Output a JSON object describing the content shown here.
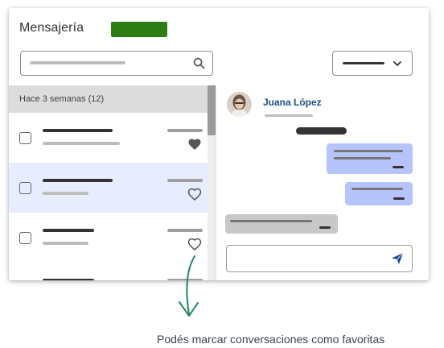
{
  "app": {
    "title": "Mensajería",
    "accent": "#2e7d12"
  },
  "search": {
    "icon": "search-icon"
  },
  "filter": {
    "icon": "chevron-down-icon"
  },
  "list": {
    "group_label": "Hace 3 semanas (12)",
    "rows": [
      {
        "favorite": true,
        "selected": false
      },
      {
        "favorite": false,
        "selected": true
      },
      {
        "favorite": false,
        "selected": false
      },
      {
        "favorite": false,
        "selected": false
      }
    ]
  },
  "chat": {
    "contact_name": "Juana López",
    "outgoing_color": "#b5c5fb",
    "incoming_color": "#c8c8c8",
    "send_icon": "send-icon"
  },
  "caption": "Podés marcar conversaciones como favoritas",
  "arrow_color": "#1f8a5a"
}
